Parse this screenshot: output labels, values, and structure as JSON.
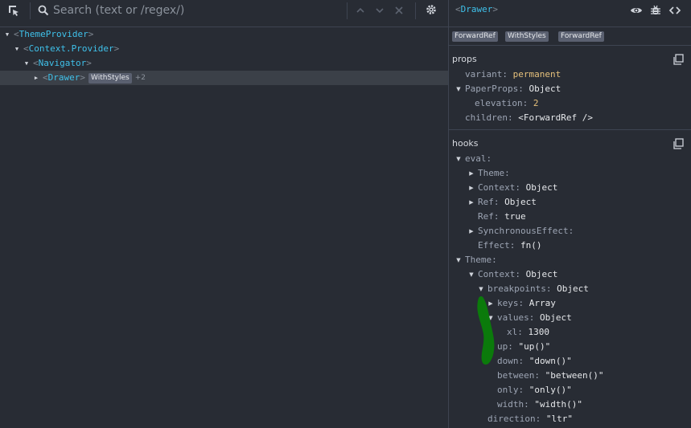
{
  "search": {
    "placeholder": "Search (text or /regex/)"
  },
  "toolbar_icons": [
    "select-element-icon",
    "search-icon",
    "chevron-up-icon",
    "chevron-down-icon",
    "close-icon",
    "gear-icon"
  ],
  "tree": [
    {
      "name": "ThemeProvider",
      "expanded": true
    },
    {
      "name": "Context.Provider",
      "expanded": true
    },
    {
      "name": "Navigator",
      "expanded": true
    },
    {
      "name": "Drawer",
      "expanded": false,
      "badge": "WithStyles",
      "more": "+2",
      "selected": true
    }
  ],
  "inspector": {
    "title": "Drawer",
    "icons": [
      "eye-icon",
      "bug-icon",
      "code-icon"
    ],
    "hoc_badges": [
      "ForwardRef",
      "WithStyles",
      "ForwardRef"
    ]
  },
  "props": {
    "title": "props",
    "rows": [
      {
        "key": "variant",
        "value": "permanent"
      },
      {
        "key": "PaperProps",
        "value": "Object"
      },
      {
        "key": "elevation",
        "value": "2"
      },
      {
        "key": "children",
        "value": "<ForwardRef />"
      }
    ]
  },
  "hooks": {
    "title": "hooks",
    "rows": [
      {
        "key": "eval",
        "value": ""
      },
      {
        "key": "Theme",
        "value": ""
      },
      {
        "key": "Context",
        "value": "Object"
      },
      {
        "key": "Ref",
        "value": "Object"
      },
      {
        "key": "Ref",
        "value": "true"
      },
      {
        "key": "SynchronousEffect",
        "value": ""
      },
      {
        "key": "Effect",
        "value": "fn()"
      },
      {
        "key": "Theme",
        "value": ""
      },
      {
        "key": "Context",
        "value": "Object"
      },
      {
        "key": "breakpoints",
        "value": "Object"
      },
      {
        "key": "keys",
        "value": "Array"
      },
      {
        "key": "values",
        "value": "Object"
      },
      {
        "key": "xl",
        "value": "1300"
      },
      {
        "key": "up",
        "value": "\"up()\""
      },
      {
        "key": "down",
        "value": "\"down()\""
      },
      {
        "key": "between",
        "value": "\"between()\""
      },
      {
        "key": "only",
        "value": "\"only()\""
      },
      {
        "key": "width",
        "value": "\"width()\""
      },
      {
        "key": "direction",
        "value": "\"ltr\""
      }
    ]
  },
  "colors": {
    "background": "#282c34",
    "component": "#3fc1ea",
    "string_value": "#e5c07b",
    "annotation": "#0b7a0b"
  }
}
